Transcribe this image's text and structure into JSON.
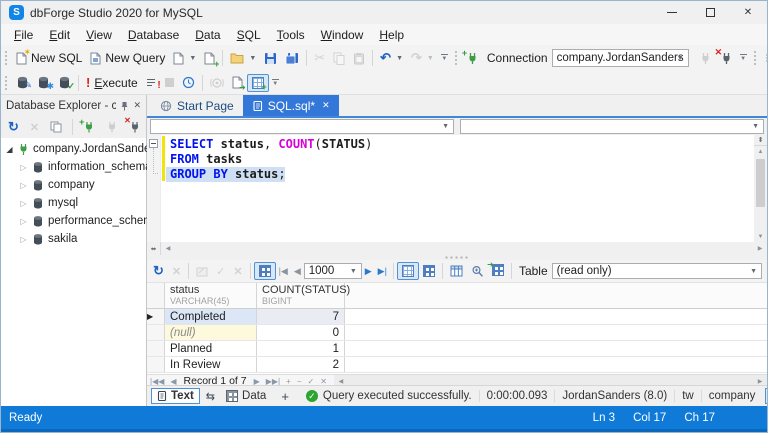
{
  "window": {
    "title": "dbForge Studio 2020 for MySQL"
  },
  "menu": {
    "items": [
      "File",
      "Edit",
      "View",
      "Database",
      "Data",
      "SQL",
      "Tools",
      "Window",
      "Help"
    ]
  },
  "toolbar_standard": {
    "new_sql": "New SQL",
    "new_query": "New Query",
    "connection_label": "Connection",
    "connection_value": "company.JordanSanders"
  },
  "toolbar_sql": {
    "execute": "Execute"
  },
  "explorer": {
    "title": "Database Explorer - comp...",
    "connection": "company.JordanSanders",
    "databases": [
      "information_schema",
      "company",
      "mysql",
      "performance_schema",
      "sakila"
    ]
  },
  "tabs": {
    "start_page": "Start Page",
    "sql_doc": "SQL.sql*"
  },
  "editor": {
    "combo1_value": "",
    "combo2_value": "",
    "line1": {
      "kw": "SELECT",
      "id1": " status",
      "p1": ", ",
      "fn": "COUNT",
      "p2": "(",
      "id2": "STATUS",
      "p3": ")"
    },
    "line2": {
      "kw": "FROM",
      "id1": " tasks"
    },
    "line3": {
      "kw": "GROUP BY",
      "id1": " status",
      "p1": ";"
    }
  },
  "results_toolbar": {
    "page_size": "1000",
    "table_label": "Table",
    "table_mode": "(read only)"
  },
  "grid": {
    "columns": [
      {
        "name": "status",
        "type": "VARCHAR(45)"
      },
      {
        "name": "COUNT(STATUS)",
        "type": "BIGINT"
      }
    ],
    "rows": [
      {
        "status": "Completed",
        "count": "7"
      },
      {
        "status": "(null)",
        "count": "0"
      },
      {
        "status": "Planned",
        "count": "1"
      },
      {
        "status": "In Review",
        "count": "2"
      }
    ]
  },
  "record_nav": {
    "label": "Record 1 of 7"
  },
  "doc_statusbar": {
    "text_tab": "Text",
    "data_tab": "Data",
    "message": "Query executed successfully.",
    "duration": "0:00:00.093",
    "connection": "JordanSanders (8.0)",
    "user": "tw",
    "database": "company"
  },
  "statusbar": {
    "ready": "Ready",
    "line": "Ln 3",
    "col": "Col 17",
    "ch": "Ch 17"
  },
  "colors": {
    "accent_blue": "#3378d8",
    "statusbar_blue": "#0f7ad8",
    "success_green": "#2ca430",
    "keyword_blue": "#0013ee",
    "function_magenta": "#d800d8",
    "null_row_yellow": "#fcf9dc",
    "selected_row_blue": "#dbe7f6",
    "change_bar_yellow": "#f1e40b"
  }
}
